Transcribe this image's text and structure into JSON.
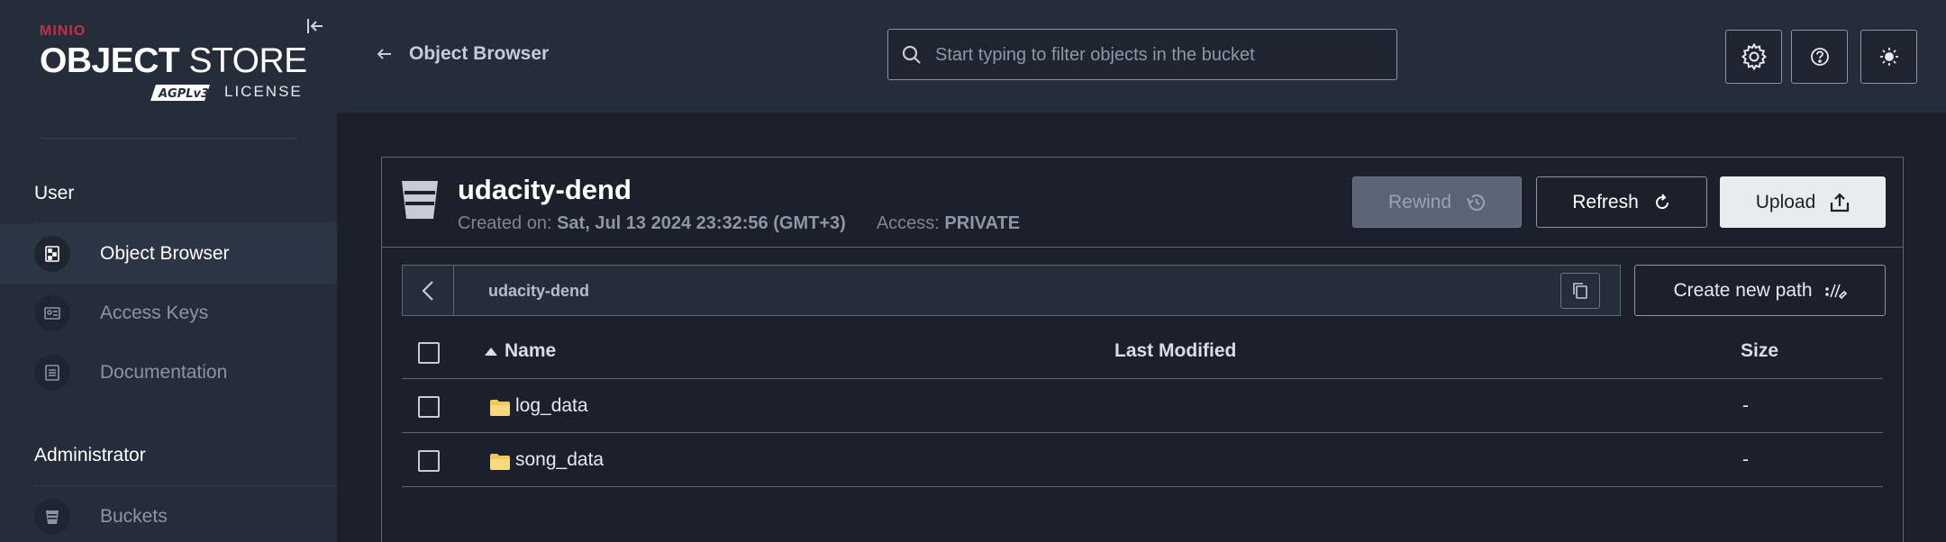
{
  "brand": {
    "minio": "MINIO",
    "object": "OBJECT",
    "store": "STORE",
    "agpl": "AGPLv3",
    "license": "LICENSE"
  },
  "sidebar": {
    "sections": [
      {
        "title": "User",
        "items": [
          {
            "label": "Object Browser",
            "icon": "object-browser-icon",
            "active": true
          },
          {
            "label": "Access Keys",
            "icon": "access-keys-icon",
            "active": false
          },
          {
            "label": "Documentation",
            "icon": "documentation-icon",
            "active": false
          }
        ]
      },
      {
        "title": "Administrator",
        "items": [
          {
            "label": "Buckets",
            "icon": "bucket-icon",
            "active": false
          }
        ]
      }
    ]
  },
  "header": {
    "back_label": "Object Browser",
    "search_placeholder": "Start typing to filter objects in the bucket",
    "search_value": "",
    "buttons": [
      "gear-icon",
      "help-icon",
      "theme-toggle-icon"
    ]
  },
  "bucket": {
    "name": "udacity-dend",
    "created_label": "Created on:",
    "created_value": "Sat, Jul 13 2024 23:32:56 (GMT+3)",
    "access_label": "Access:",
    "access_value": "PRIVATE",
    "rewind_label": "Rewind",
    "refresh_label": "Refresh",
    "upload_label": "Upload",
    "path": "udacity-dend",
    "new_path_label": "Create new path"
  },
  "table": {
    "columns": {
      "name": "Name",
      "last_modified": "Last Modified",
      "size": "Size"
    },
    "sort": {
      "column": "name",
      "direction": "ascending"
    },
    "rows": [
      {
        "name": "log_data",
        "last_modified": "",
        "size": "-"
      },
      {
        "name": "song_data",
        "last_modified": "",
        "size": "-"
      }
    ]
  },
  "colors": {
    "sidebar_bg": "#252d3a",
    "page_bg": "#1b202a",
    "brand_red": "#c72c48",
    "folder": "#f2c85b",
    "upload_bg": "#e8ecef"
  }
}
